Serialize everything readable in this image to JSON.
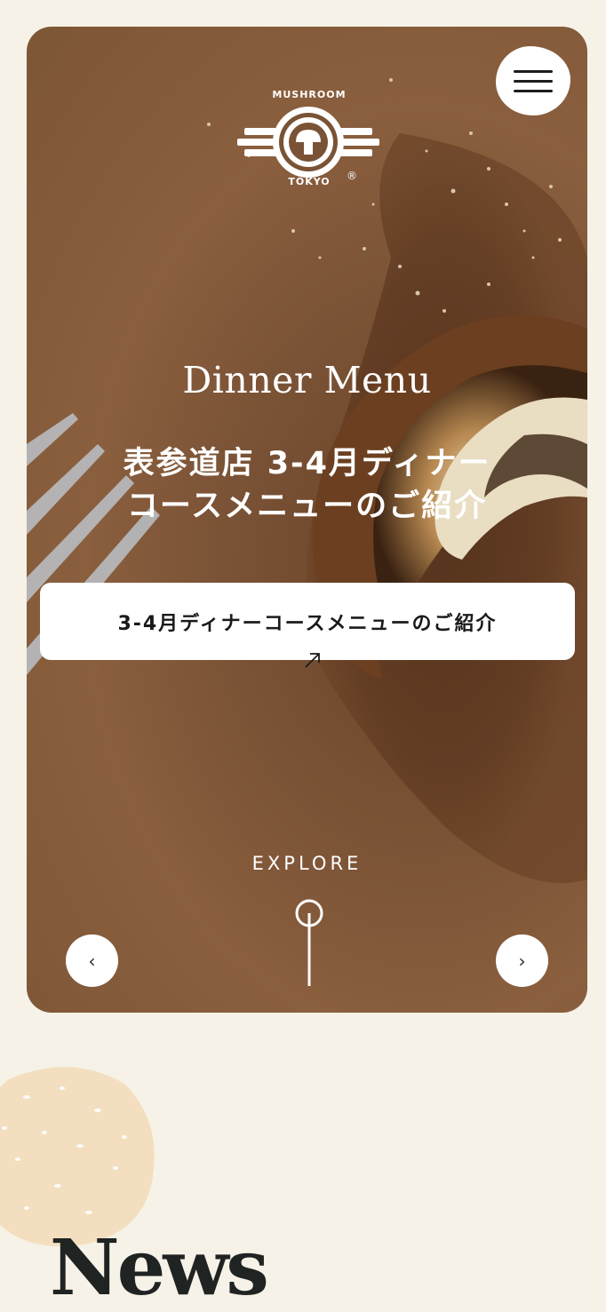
{
  "header": {
    "logo_top_text": "MUSHROOM",
    "logo_bottom_text": "TOKYO",
    "logo_mark": "®",
    "menu_icon": "hamburger-menu-icon"
  },
  "hero": {
    "title": "Dinner Menu",
    "subtitle_line1": "表参道店 3-4月ディナー",
    "subtitle_line2": "コースメニューのご紹介",
    "cta_label": "3-4月ディナーコースメニューのご紹介",
    "cta_icon": "arrow-up-right-icon",
    "explore_label": "EXPLORE",
    "prev_label": "‹",
    "next_label": "›"
  },
  "news": {
    "title": "News"
  },
  "colors": {
    "background": "#f6f2e7",
    "hero_brown": "#7a5235",
    "white": "#ffffff",
    "text_dark": "#1f2322",
    "blob": "#f3dfbf"
  }
}
